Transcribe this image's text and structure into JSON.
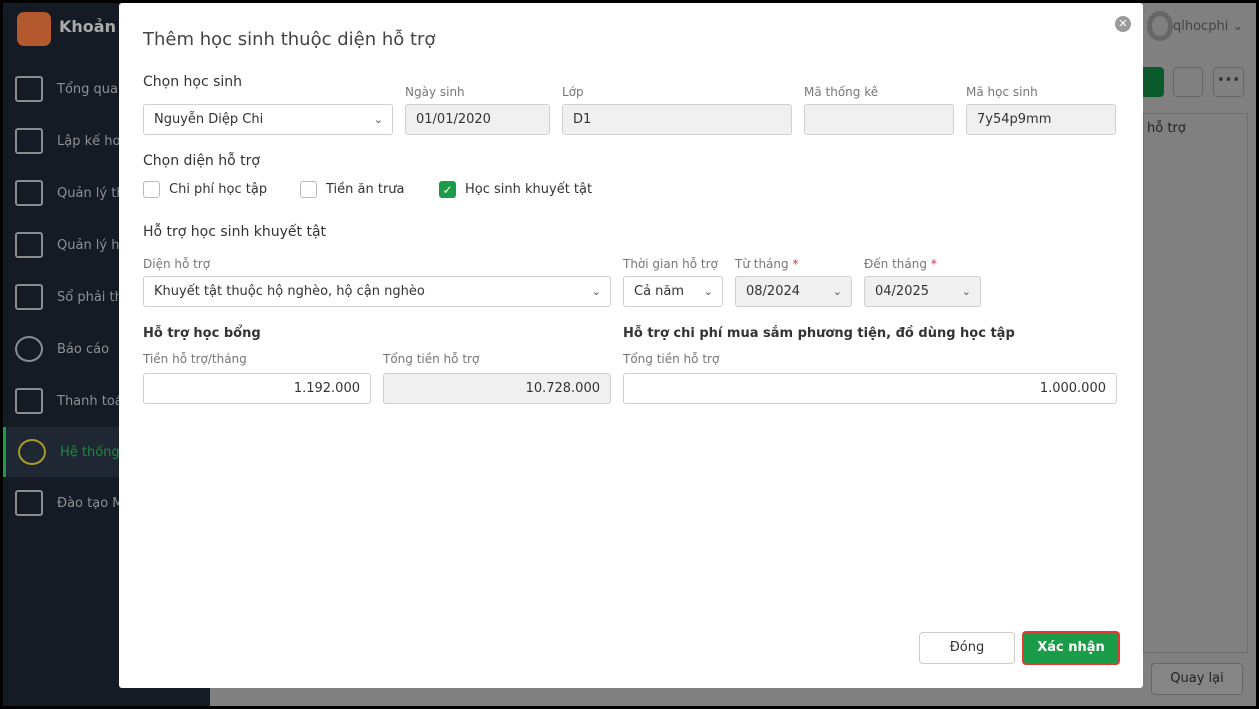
{
  "app": {
    "title": "Khoản t",
    "user": "qlhocphi"
  },
  "sidebar": {
    "items": [
      {
        "label": "Tổng quan"
      },
      {
        "label": "Lập kế hoạ"
      },
      {
        "label": "Quản lý thu"
      },
      {
        "label": "Quản lý hó"
      },
      {
        "label": "Sổ phải thu"
      },
      {
        "label": "Báo cáo"
      },
      {
        "label": "Thanh toán"
      },
      {
        "label": "Hệ thống"
      },
      {
        "label": "Đào tạo M"
      }
    ]
  },
  "background": {
    "column_header": "hỗ trợ",
    "back_button": "Quay lại"
  },
  "dialog": {
    "title": "Thêm học sinh thuộc diện hỗ trợ",
    "student": {
      "label": "Chọn học sinh",
      "value": "Nguyễn Diệp Chi"
    },
    "dob": {
      "label": "Ngày sinh",
      "value": "01/01/2020"
    },
    "class": {
      "label": "Lớp",
      "value": "D1"
    },
    "stat_code": {
      "label": "Mã thống kê",
      "value": ""
    },
    "student_code": {
      "label": "Mã học sinh",
      "value": "7y54p9mm"
    },
    "support_types": {
      "label": "Chọn diện hỗ trợ",
      "options": [
        {
          "label": "Chi phí học tập",
          "checked": false
        },
        {
          "label": "Tiền ăn trưa",
          "checked": false
        },
        {
          "label": "Học sinh khuyết tật",
          "checked": true
        }
      ]
    },
    "disabled_section": {
      "title": "Hỗ trợ học sinh khuyết tật",
      "category": {
        "label": "Diện hỗ trợ",
        "value": "Khuyết tật thuộc hộ nghèo, hộ cận nghèo"
      },
      "period": {
        "label": "Thời gian hỗ trợ",
        "value": "Cả năm"
      },
      "from": {
        "label": "Từ tháng",
        "value": "08/2024"
      },
      "to": {
        "label": "Đến tháng",
        "value": "04/2025"
      },
      "required_mark": "*"
    },
    "scholarship": {
      "title": "Hỗ trợ học bổng",
      "monthly_label": "Tiền hỗ trợ/tháng",
      "monthly_value": "1.192.000",
      "total_label": "Tổng tiền hỗ trợ",
      "total_value": "10.728.000"
    },
    "equipment": {
      "title": "Hỗ trợ chi phí mua sắm phương tiện, đồ dùng học tập",
      "total_label": "Tổng tiền hỗ trợ",
      "total_value": "1.000.000"
    },
    "close_button": "Đóng",
    "confirm_button": "Xác nhận"
  }
}
